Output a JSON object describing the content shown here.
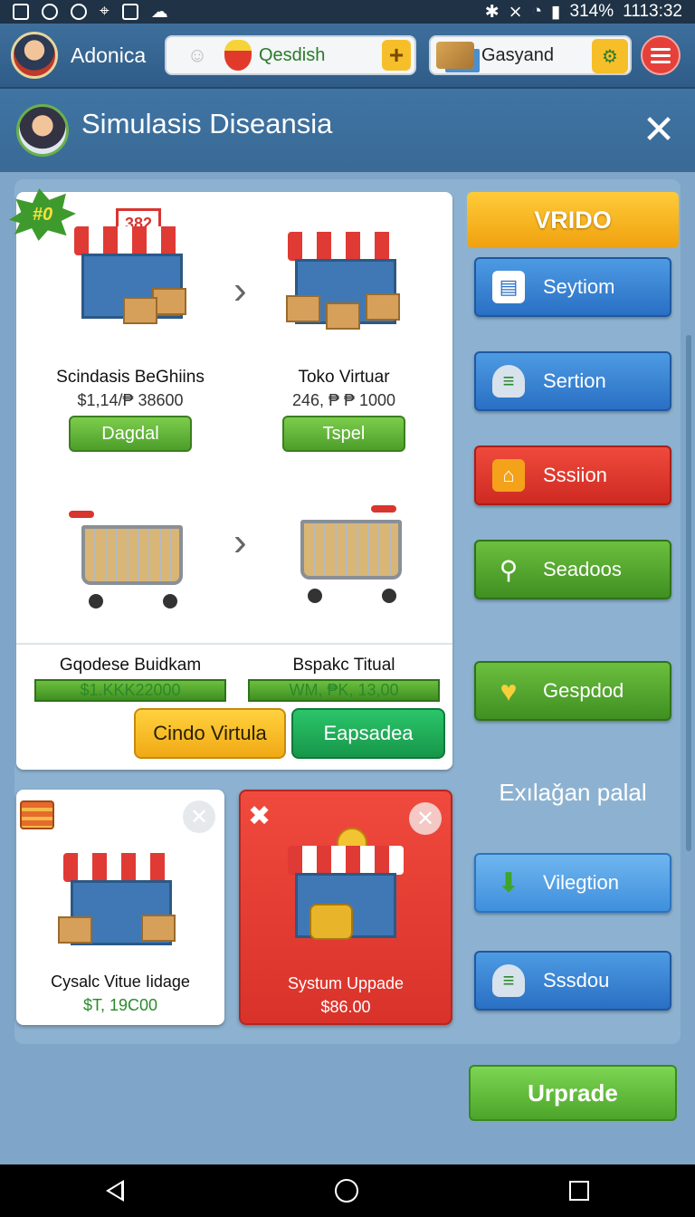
{
  "status_bar": {
    "battery": "314%",
    "time": "1113:32"
  },
  "top_bar": {
    "player_name": "Adonica",
    "resource_1": {
      "label": "Qesdish",
      "icon": "fruit-icon",
      "action": "+"
    },
    "resource_2": {
      "label": "Gasyand",
      "icon": "crate-icon"
    }
  },
  "panel": {
    "title": "Simulasis Diseansia",
    "badge": "#0"
  },
  "shop_items": [
    {
      "name": "Scindasis BeGhiins",
      "price": "$1,14/₱ 38600",
      "button": "Dagdal"
    },
    {
      "name": "Toko Virtuar",
      "price": "246, ₱ ₱ 1000",
      "button": "Tspel"
    },
    {
      "name": "Gqodese Buidkam",
      "price": "$1.KKK22000"
    },
    {
      "name": "Bspakc Titual",
      "price": "WM, ₱K, 13,00"
    }
  ],
  "actions": {
    "primary": "Cindo Virtula",
    "secondary": "Eapsadea"
  },
  "offers": [
    {
      "name": "Cysalc Vitue Iidage",
      "price": "$T, 19C00"
    },
    {
      "name": "Systum Uppade",
      "price": "$86.00"
    }
  ],
  "side_menu": {
    "header": "VRIDO",
    "buttons": [
      {
        "label": "Seytiom",
        "icon": "document-icon"
      },
      {
        "label": "Sertion",
        "icon": "database-icon"
      },
      {
        "label": "Sssiion",
        "icon": "house-icon"
      },
      {
        "label": "Seadoos",
        "icon": "magnifier-icon"
      },
      {
        "label": "Gespdod",
        "icon": "heart-icon"
      }
    ],
    "section_text": "Exılaǧan palal",
    "buttons_2": [
      {
        "label": "Vilegtion",
        "icon": "download-arrow-icon"
      },
      {
        "label": "Sssdou",
        "icon": "database-icon"
      }
    ],
    "upgrade": "Urprade"
  },
  "colors": {
    "accent_yellow": "#f6bf2a",
    "brand_blue": "#2f5c88",
    "action_green": "#4ca52a",
    "alert_red": "#e5403a"
  }
}
